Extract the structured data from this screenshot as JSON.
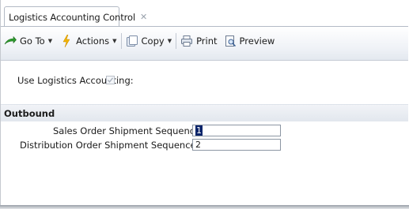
{
  "tab": {
    "title": "Logistics Accounting Control",
    "close_glyph": "✕"
  },
  "toolbar": {
    "goto_label": "Go To",
    "actions_label": "Actions",
    "copy_label": "Copy",
    "print_label": "Print",
    "preview_label": "Preview",
    "caret_glyph": "▼",
    "icons": {
      "goto": "arrow-icon",
      "actions": "lightning-icon",
      "copy": "copy-icon",
      "print": "printer-icon",
      "preview": "preview-icon"
    }
  },
  "form": {
    "use_logistics_accounting_label": "Use Logistics Accounting:",
    "use_logistics_accounting_checked": true,
    "section_title": "Outbound",
    "sales_order_label": "Sales Order Shipment Sequence ID:",
    "sales_order_value": "1",
    "distribution_order_label": "Distribution Order Shipment Sequence ID:",
    "distribution_order_value": "2"
  },
  "colors": {
    "selection": "#0a246a",
    "goto_arrow": "#2e9a2e",
    "actions_bolt": "#f2b400"
  }
}
